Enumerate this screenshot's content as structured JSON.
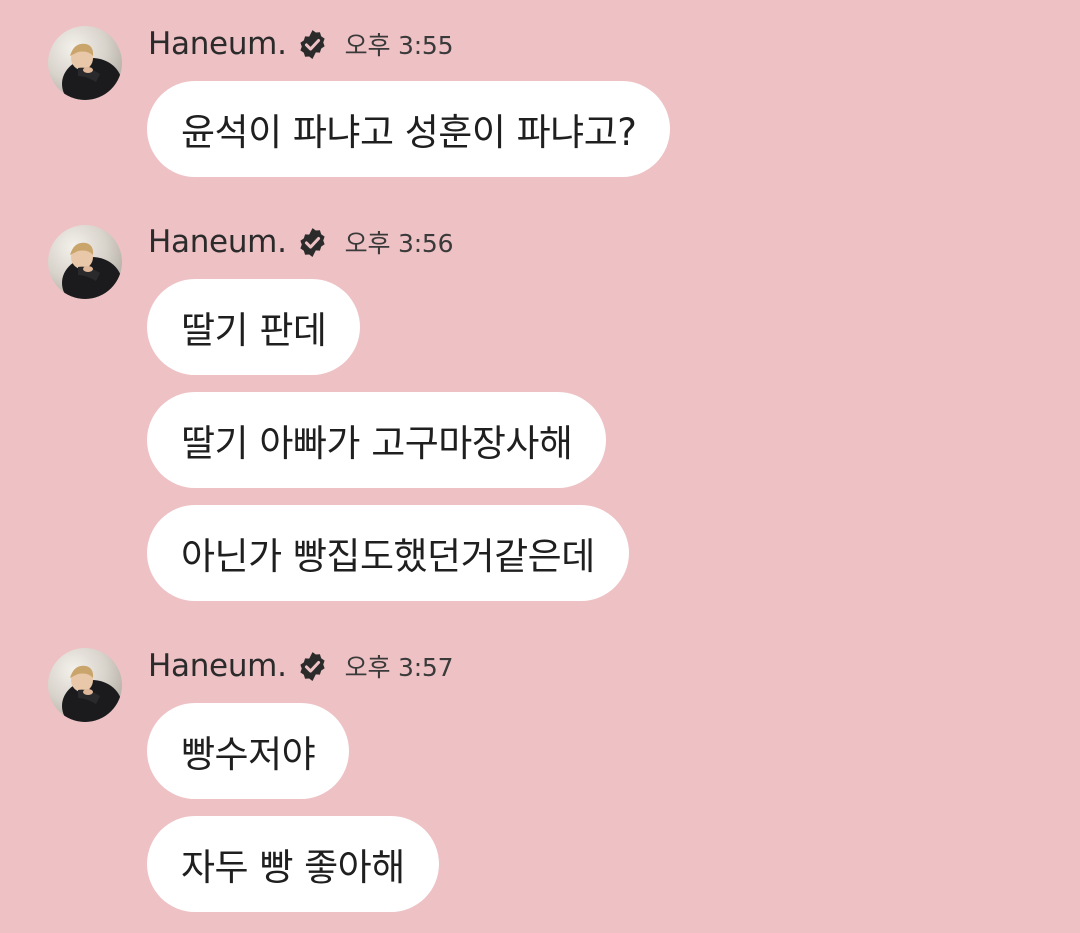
{
  "messages": [
    {
      "sender": "Haneum.",
      "time": "오후 3:55",
      "bubbles": [
        "윤석이 파냐고 성훈이 파냐고?"
      ]
    },
    {
      "sender": "Haneum.",
      "time": "오후 3:56",
      "bubbles": [
        "딸기 판데",
        "딸기 아빠가 고구마장사해",
        "아닌가 빵집도했던거같은데"
      ]
    },
    {
      "sender": "Haneum.",
      "time": "오후 3:57",
      "bubbles": [
        "빵수저야",
        "자두 빵 좋아해"
      ]
    }
  ],
  "colors": {
    "background": "#EEC1C4",
    "bubble": "#FFFFFF",
    "verified_badge": "#2B2B2B"
  },
  "icons": {
    "verified": "verified-badge-icon",
    "avatar": "profile-avatar"
  }
}
